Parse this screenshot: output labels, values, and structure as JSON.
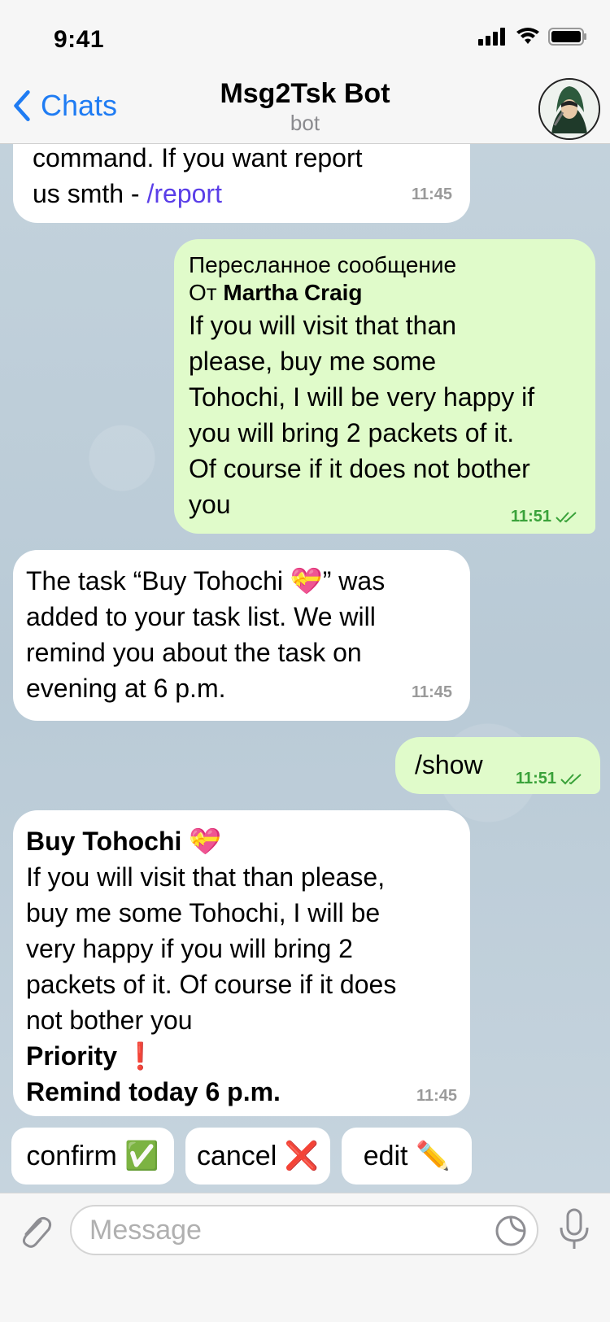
{
  "status_bar": {
    "time": "9:41"
  },
  "header": {
    "back_label": "Chats",
    "title": "Msg2Tsk Bot",
    "subtitle": "bot"
  },
  "messages": [
    {
      "line1": "command. If you want report",
      "line2_text": "us smth - ",
      "line2_link": "/report",
      "time": "11:45"
    },
    {
      "forward_header": "Пересланное сообщение",
      "from_prefix": "От ",
      "from_name": "Martha Craig",
      "lines": [
        "If you will visit that than",
        "please, buy me some",
        "Tohochi, I will be very happy if",
        "you will bring 2 packets of it.",
        "Of course if it does not bother",
        "you"
      ],
      "time": "11:51"
    },
    {
      "lines": [
        "The task “Buy Tohochi 💝”  was",
        "added to your task list. We will",
        "remind you about the task on",
        "evening at 6 p.m."
      ],
      "time": "11:45"
    },
    {
      "text": "/show",
      "time": "11:51"
    },
    {
      "title": "Buy Tohochi 💝",
      "lines": [
        "If you will visit that than please,",
        "buy me some Tohochi, I will be",
        "very happy if you will bring 2",
        "packets of it. Of course if it does",
        "not bother you"
      ],
      "priority": "Priority ❗",
      "remind": "Remind today 6 p.m.",
      "time": "11:45"
    }
  ],
  "keyboard": {
    "confirm": "confirm ✅",
    "cancel": "cancel ❌",
    "edit": "edit ✏️"
  },
  "input": {
    "placeholder": "Message"
  },
  "colors": {
    "accent": "#1f7cf3",
    "outgoing_bubble": "#e0fbca",
    "incoming_bubble": "#ffffff",
    "read_check": "#3aa23a"
  }
}
